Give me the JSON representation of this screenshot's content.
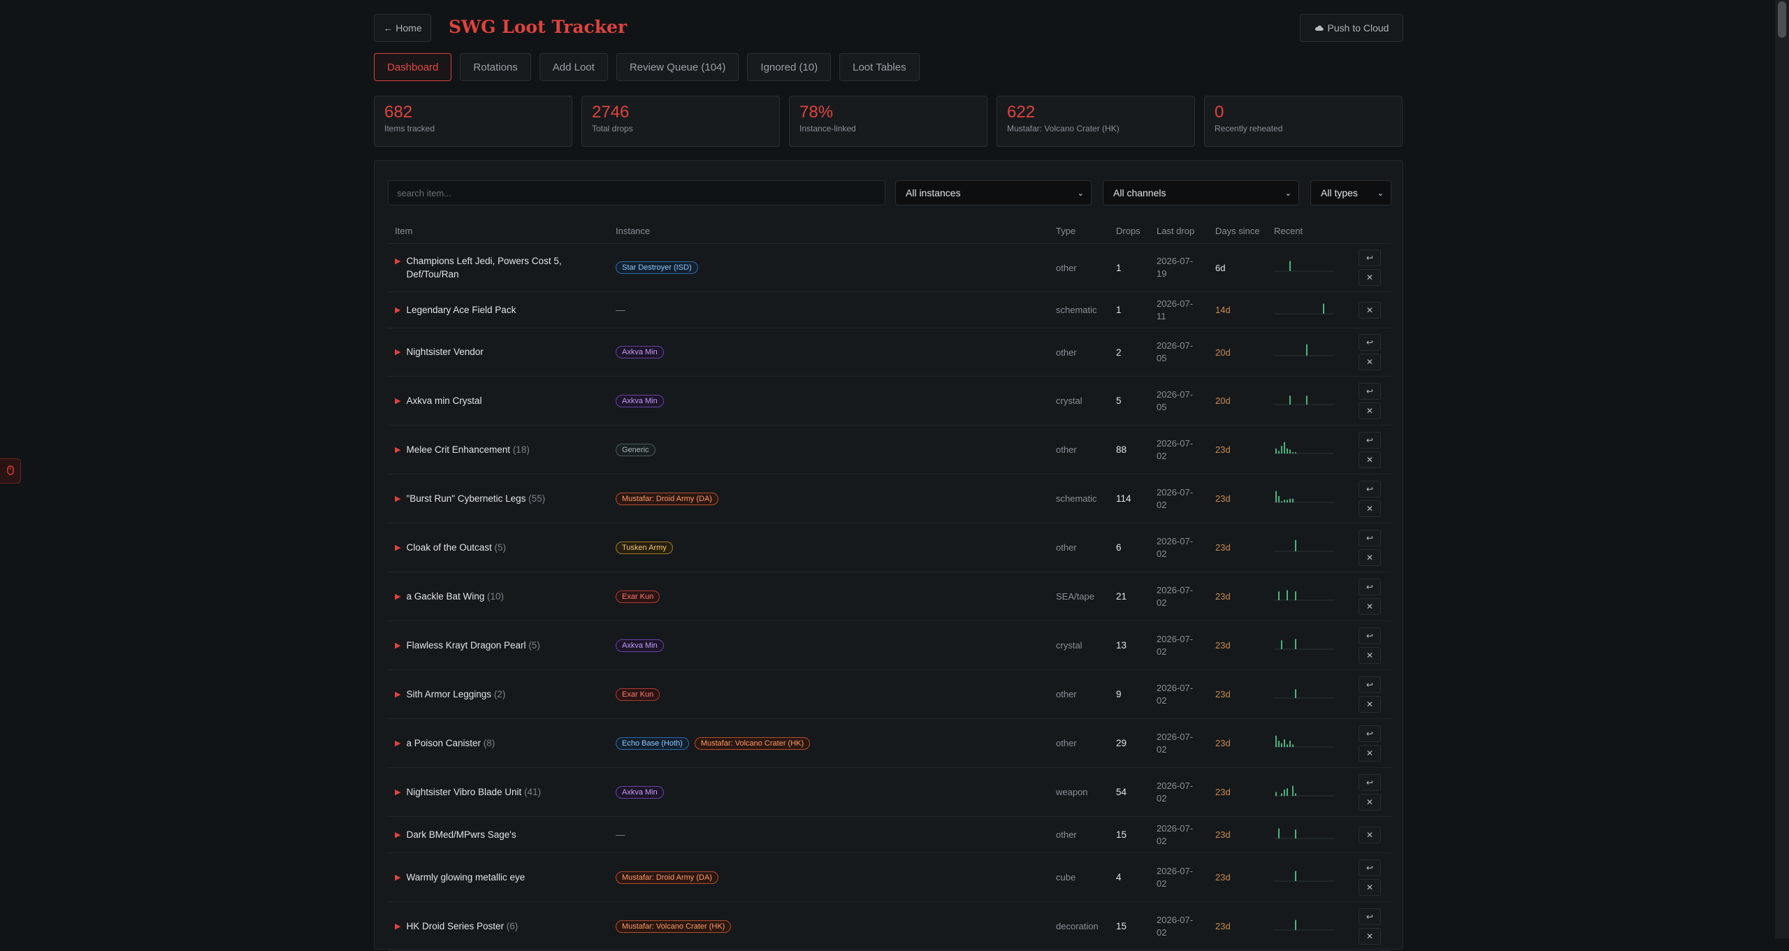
{
  "header": {
    "home_label": "← Home",
    "title": "SWG Loot Tracker",
    "push_label": "Push to Cloud"
  },
  "tabs": [
    {
      "label": "Dashboard",
      "active": true
    },
    {
      "label": "Rotations"
    },
    {
      "label": "Add Loot"
    },
    {
      "label": "Review Queue (104)"
    },
    {
      "label": "Ignored (10)"
    },
    {
      "label": "Loot Tables"
    }
  ],
  "stats": [
    {
      "value": "682",
      "label": "Items tracked"
    },
    {
      "value": "2746",
      "label": "Total drops"
    },
    {
      "value": "78%",
      "label": "Instance-linked"
    },
    {
      "value": "622",
      "label": "Mustafar: Volcano Crater (HK)"
    },
    {
      "value": "0",
      "label": "Recently reheated"
    }
  ],
  "filters": {
    "search_placeholder": "search item...",
    "instance": "All instances",
    "channel": "All channels",
    "type": "All types"
  },
  "columns": [
    "Item",
    "Instance",
    "Type",
    "Drops",
    "Last drop",
    "Days since",
    "Recent"
  ],
  "rows": [
    {
      "name": "Champions Left Jedi, Powers Cost 5, Def/Tou/Ran",
      "count": "",
      "badges": [
        {
          "t": "Star Destroyer (ISD)",
          "c": "blue"
        }
      ],
      "type": "other",
      "drops": "1",
      "date1": "2026-07-",
      "date2": "19",
      "days": "6d",
      "fresh": true,
      "bars": [
        0,
        0,
        0,
        0,
        0,
        8,
        0,
        0,
        0,
        0,
        0,
        0,
        0,
        0,
        0,
        0,
        0,
        0,
        0,
        0,
        0
      ],
      "actions": 2
    },
    {
      "name": "Legendary Ace Field Pack",
      "count": "",
      "badges": [],
      "type": "schematic",
      "drops": "1",
      "date1": "2026-07-",
      "date2": "11",
      "days": "14d",
      "fresh": false,
      "bars": [
        0,
        0,
        0,
        0,
        0,
        0,
        0,
        0,
        0,
        0,
        0,
        0,
        0,
        0,
        0,
        0,
        0,
        8,
        0,
        0,
        0
      ],
      "actions": 1
    },
    {
      "name": "Nightsister Vendor",
      "count": "",
      "badges": [
        {
          "t": "Axkva Min",
          "c": "purple"
        }
      ],
      "type": "other",
      "drops": "2",
      "date1": "2026-07-",
      "date2": "05",
      "days": "20d",
      "fresh": false,
      "bars": [
        0,
        0,
        0,
        0,
        0,
        0,
        0,
        0,
        0,
        0,
        0,
        9,
        0,
        0,
        0,
        0,
        0,
        0,
        0,
        0,
        0
      ],
      "actions": 2
    },
    {
      "name": "Axkva min Crystal",
      "count": "",
      "badges": [
        {
          "t": "Axkva Min",
          "c": "purple"
        }
      ],
      "type": "crystal",
      "drops": "5",
      "date1": "2026-07-",
      "date2": "05",
      "days": "20d",
      "fresh": false,
      "bars": [
        0,
        0,
        0,
        0,
        0,
        7,
        0,
        0,
        0,
        0,
        0,
        7,
        0,
        0,
        0,
        0,
        0,
        0,
        0,
        0,
        0
      ],
      "actions": 2
    },
    {
      "name": "Melee Crit Enhancement",
      "count": "(18)",
      "badges": [
        {
          "t": "Generic",
          "c": "gray"
        }
      ],
      "type": "other",
      "drops": "88",
      "date1": "2026-07-",
      "date2": "02",
      "days": "23d",
      "fresh": false,
      "bars": [
        4,
        2,
        6,
        9,
        4,
        3,
        1,
        1,
        0,
        0,
        0,
        0,
        0,
        0,
        0,
        0,
        0,
        0,
        0,
        0,
        0
      ],
      "actions": 2
    },
    {
      "name": "\"Burst Run\" Cybernetic Legs",
      "count": "(55)",
      "badges": [
        {
          "t": "Mustafar: Droid Army (DA)",
          "c": "orange"
        }
      ],
      "type": "schematic",
      "drops": "114",
      "date1": "2026-07-",
      "date2": "02",
      "days": "23d",
      "fresh": false,
      "bars": [
        9,
        5,
        1,
        2,
        2,
        3,
        3,
        0,
        0,
        0,
        0,
        0,
        0,
        0,
        0,
        0,
        0,
        0,
        0,
        0,
        0
      ],
      "actions": 2
    },
    {
      "name": "Cloak of the Outcast",
      "count": "(5)",
      "badges": [
        {
          "t": "Tusken Army",
          "c": "yellow"
        }
      ],
      "type": "other",
      "drops": "6",
      "date1": "2026-07-",
      "date2": "02",
      "days": "23d",
      "fresh": false,
      "bars": [
        0,
        0,
        0,
        0,
        0,
        0,
        0,
        9,
        0,
        0,
        0,
        0,
        0,
        0,
        0,
        0,
        0,
        0,
        0,
        0,
        0
      ],
      "actions": 2
    },
    {
      "name": "a Gackle Bat Wing",
      "count": "(10)",
      "badges": [
        {
          "t": "Exar Kun",
          "c": "red"
        }
      ],
      "type": "SEA/tape",
      "drops": "21",
      "date1": "2026-07-",
      "date2": "02",
      "days": "23d",
      "fresh": false,
      "bars": [
        0,
        7,
        0,
        0,
        8,
        0,
        0,
        7,
        0,
        0,
        0,
        0,
        0,
        0,
        0,
        0,
        0,
        0,
        0,
        0,
        0
      ],
      "actions": 2
    },
    {
      "name": "Flawless Krayt Dragon Pearl",
      "count": "(5)",
      "badges": [
        {
          "t": "Axkva Min",
          "c": "purple"
        }
      ],
      "type": "crystal",
      "drops": "13",
      "date1": "2026-07-",
      "date2": "02",
      "days": "23d",
      "fresh": false,
      "bars": [
        0,
        0,
        7,
        0,
        0,
        0,
        0,
        8,
        0,
        0,
        0,
        0,
        0,
        0,
        0,
        0,
        0,
        0,
        0,
        0,
        0
      ],
      "actions": 2
    },
    {
      "name": "Sith Armor Leggings",
      "count": "(2)",
      "badges": [
        {
          "t": "Exar Kun",
          "c": "red"
        }
      ],
      "type": "other",
      "drops": "9",
      "date1": "2026-07-",
      "date2": "02",
      "days": "23d",
      "fresh": false,
      "bars": [
        0,
        0,
        0,
        0,
        0,
        0,
        0,
        7,
        0,
        0,
        0,
        0,
        0,
        0,
        0,
        0,
        0,
        0,
        0,
        0,
        0
      ],
      "actions": 2
    },
    {
      "name": "a Poison Canister",
      "count": "(8)",
      "badges": [
        {
          "t": "Echo Base (Hoth)",
          "c": "blue"
        },
        {
          "t": "Mustafar: Volcano Crater (HK)",
          "c": "orange"
        }
      ],
      "type": "other",
      "drops": "29",
      "date1": "2026-07-",
      "date2": "02",
      "days": "23d",
      "fresh": false,
      "bars": [
        9,
        5,
        3,
        6,
        2,
        5,
        2,
        0,
        0,
        0,
        0,
        0,
        0,
        0,
        0,
        0,
        0,
        0,
        0,
        0,
        0
      ],
      "actions": 2
    },
    {
      "name": "Nightsister Vibro Blade Unit",
      "count": "(41)",
      "badges": [
        {
          "t": "Axkva Min",
          "c": "purple"
        }
      ],
      "type": "weapon",
      "drops": "54",
      "date1": "2026-07-",
      "date2": "02",
      "days": "23d",
      "fresh": false,
      "bars": [
        3,
        0,
        2,
        5,
        6,
        0,
        8,
        2,
        0,
        0,
        0,
        0,
        0,
        0,
        0,
        0,
        0,
        0,
        0,
        0,
        0
      ],
      "actions": 2
    },
    {
      "name": "Dark BMed/MPwrs Sage's",
      "count": "",
      "badges": [],
      "type": "other",
      "drops": "15",
      "date1": "2026-07-",
      "date2": "02",
      "days": "23d",
      "fresh": false,
      "bars": [
        0,
        8,
        0,
        0,
        0,
        0,
        0,
        7,
        0,
        0,
        0,
        0,
        0,
        0,
        0,
        0,
        0,
        0,
        0,
        0,
        0
      ],
      "actions": 1
    },
    {
      "name": "Warmly glowing metallic eye",
      "count": "",
      "badges": [
        {
          "t": "Mustafar: Droid Army (DA)",
          "c": "orange"
        }
      ],
      "type": "cube",
      "drops": "4",
      "date1": "2026-07-",
      "date2": "02",
      "days": "23d",
      "fresh": false,
      "bars": [
        0,
        0,
        0,
        0,
        0,
        0,
        0,
        8,
        0,
        0,
        0,
        0,
        0,
        0,
        0,
        0,
        0,
        0,
        0,
        0,
        0
      ],
      "actions": 2
    },
    {
      "name": "HK Droid Series Poster",
      "count": "(6)",
      "badges": [
        {
          "t": "Mustafar: Volcano Crater (HK)",
          "c": "orange"
        }
      ],
      "type": "decoration",
      "drops": "15",
      "date1": "2026-07-",
      "date2": "02",
      "days": "23d",
      "fresh": false,
      "bars": [
        0,
        0,
        0,
        0,
        0,
        0,
        0,
        8,
        0,
        0,
        0,
        0,
        0,
        0,
        0,
        0,
        0,
        0,
        0,
        0,
        0
      ],
      "actions": 2
    }
  ],
  "no_instance": "—",
  "actions": {
    "restore": "↩",
    "dismiss": "✕"
  },
  "side_tab_icon": "mouse-icon",
  "colors": {
    "accent": "#e0433e",
    "spark": "#4fb37f",
    "days": "#c98a50"
  }
}
